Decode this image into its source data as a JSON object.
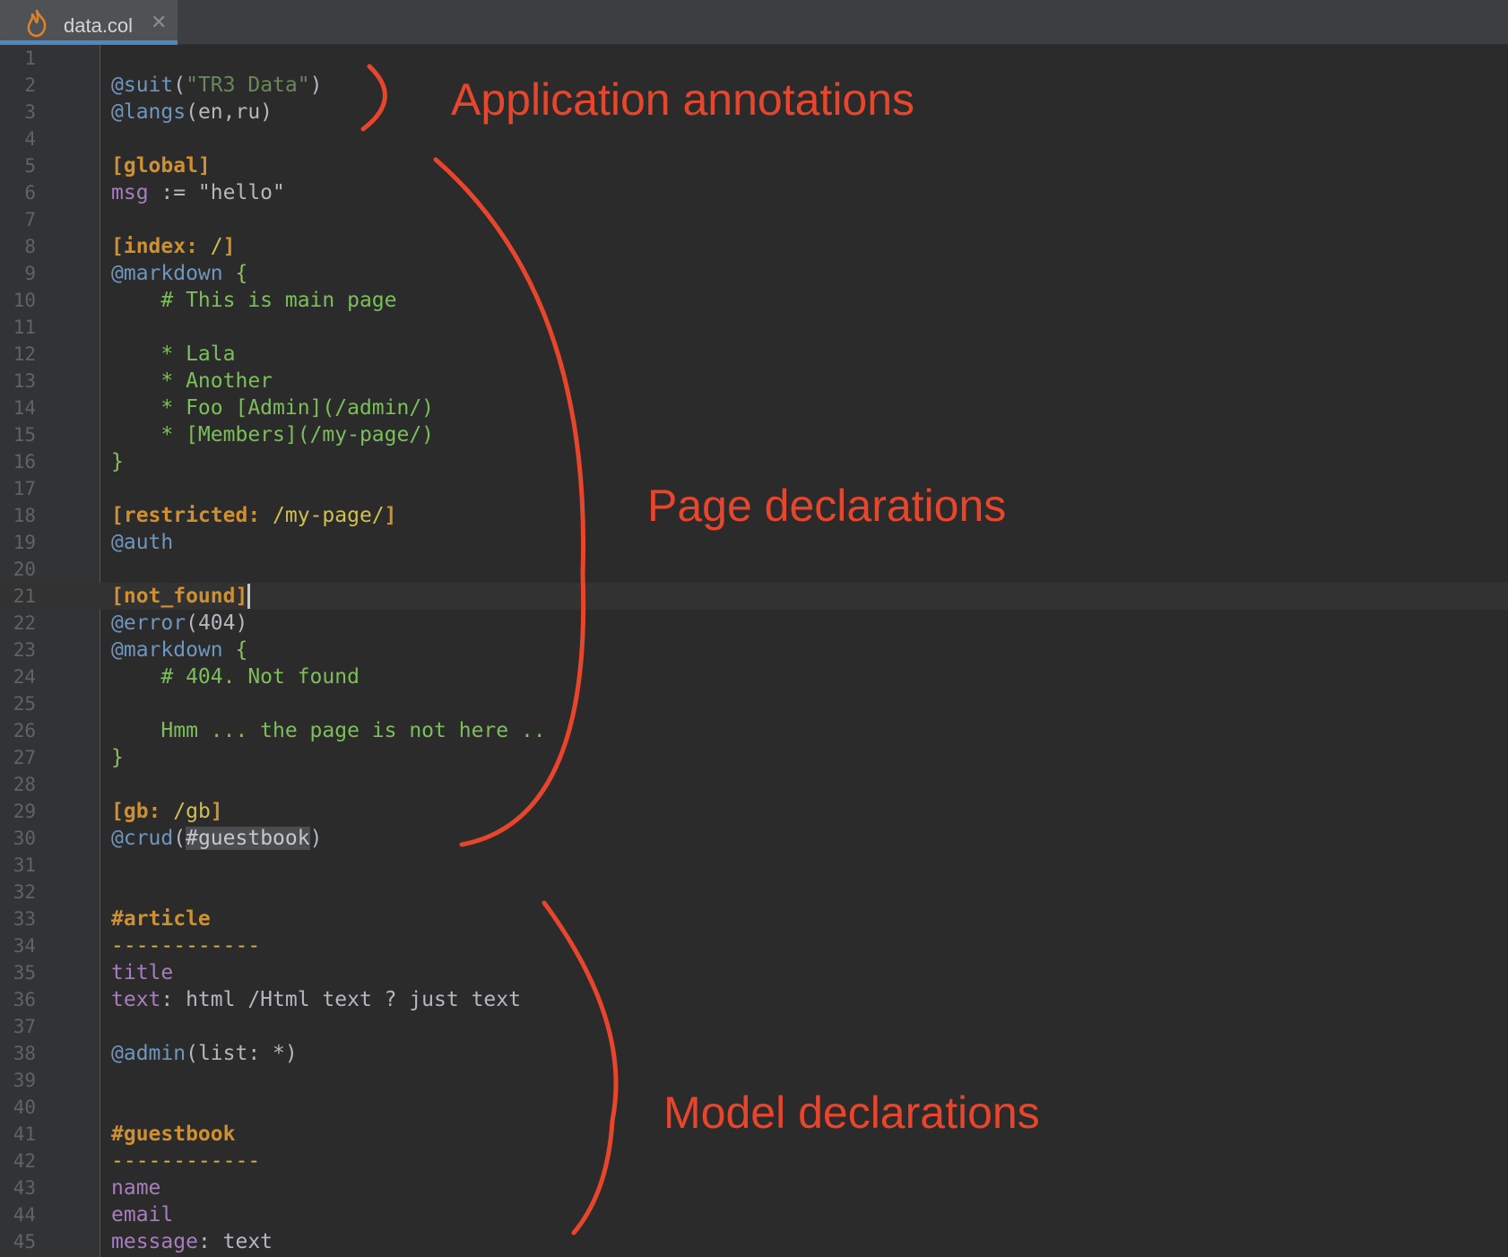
{
  "tab": {
    "title": "data.col",
    "close_glyph": "✕",
    "icon": "flame-icon"
  },
  "editor": {
    "current_line": 21,
    "lines": [
      [],
      [
        {
          "t": "@suit",
          "c": "annot"
        },
        {
          "t": "(",
          "c": "plain"
        },
        {
          "t": "\"TR3 Data\"",
          "c": "str"
        },
        {
          "t": ")",
          "c": "plain"
        }
      ],
      [
        {
          "t": "@langs",
          "c": "annot"
        },
        {
          "t": "(en,ru)",
          "c": "plain"
        }
      ],
      [],
      [
        {
          "t": "[global]",
          "c": "section"
        }
      ],
      [
        {
          "t": "msg",
          "c": "var"
        },
        {
          "t": " := \"hello\"",
          "c": "plain"
        }
      ],
      [],
      [
        {
          "t": "[index: ",
          "c": "section"
        },
        {
          "t": "/",
          "c": "path"
        },
        {
          "t": "]",
          "c": "section"
        }
      ],
      [
        {
          "t": "@markdown",
          "c": "annot"
        },
        {
          "t": " {",
          "c": "brace"
        }
      ],
      [
        {
          "t": "    # This is main page",
          "c": "md"
        }
      ],
      [],
      [
        {
          "t": "    * Lala",
          "c": "md"
        }
      ],
      [
        {
          "t": "    * Another",
          "c": "md"
        }
      ],
      [
        {
          "t": "    * Foo [Admin](/admin/)",
          "c": "md"
        }
      ],
      [
        {
          "t": "    * [Members](/my-page/)",
          "c": "md"
        }
      ],
      [
        {
          "t": "}",
          "c": "brace"
        }
      ],
      [],
      [
        {
          "t": "[restricted: ",
          "c": "section"
        },
        {
          "t": "/my-page/",
          "c": "path"
        },
        {
          "t": "]",
          "c": "section"
        }
      ],
      [
        {
          "t": "@auth",
          "c": "annot"
        }
      ],
      [],
      [
        {
          "t": "[not_found]",
          "c": "section"
        }
      ],
      [
        {
          "t": "@error",
          "c": "annot"
        },
        {
          "t": "(404)",
          "c": "plain"
        }
      ],
      [
        {
          "t": "@markdown",
          "c": "annot"
        },
        {
          "t": " {",
          "c": "brace"
        }
      ],
      [
        {
          "t": "    # 404. Not found",
          "c": "md"
        }
      ],
      [],
      [
        {
          "t": "    Hmm ... the page is not here ..",
          "c": "md"
        }
      ],
      [
        {
          "t": "}",
          "c": "brace"
        }
      ],
      [],
      [
        {
          "t": "[gb: ",
          "c": "section"
        },
        {
          "t": "/gb",
          "c": "path"
        },
        {
          "t": "]",
          "c": "section"
        }
      ],
      [
        {
          "t": "@crud",
          "c": "annot"
        },
        {
          "t": "(",
          "c": "plain"
        },
        {
          "t": "#guestbook",
          "c": "hl"
        },
        {
          "t": ")",
          "c": "plain"
        }
      ],
      [],
      [],
      [
        {
          "t": "#article",
          "c": "model"
        }
      ],
      [
        {
          "t": "------------",
          "c": "rule"
        }
      ],
      [
        {
          "t": "title",
          "c": "field"
        }
      ],
      [
        {
          "t": "text",
          "c": "field"
        },
        {
          "t": ": html /Html text ? just text",
          "c": "plain"
        }
      ],
      [],
      [
        {
          "t": "@admin",
          "c": "annot"
        },
        {
          "t": "(list: *)",
          "c": "plain"
        }
      ],
      [],
      [],
      [
        {
          "t": "#guestbook",
          "c": "model"
        }
      ],
      [
        {
          "t": "------------",
          "c": "rule"
        }
      ],
      [
        {
          "t": "name",
          "c": "field"
        }
      ],
      [
        {
          "t": "email",
          "c": "field"
        }
      ],
      [
        {
          "t": "message",
          "c": "field"
        },
        {
          "t": ": text",
          "c": "plain"
        }
      ]
    ]
  },
  "annotations": {
    "application": "Application annotations",
    "pages": "Page declarations",
    "models": "Model declarations",
    "color": "#e8462c"
  }
}
